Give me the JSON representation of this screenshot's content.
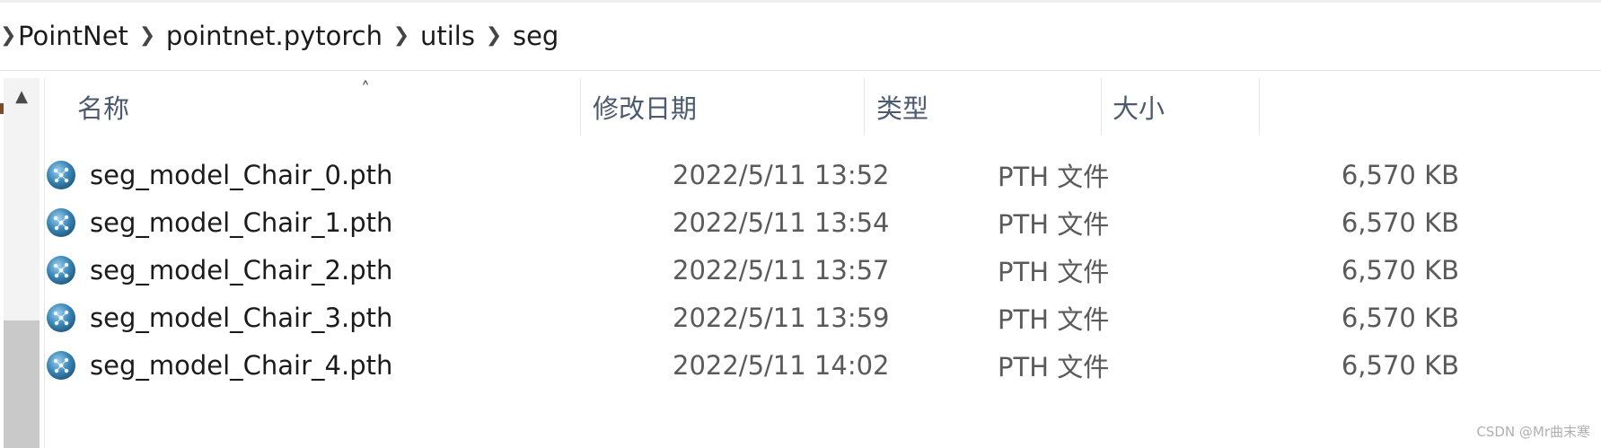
{
  "breadcrumb": {
    "items": [
      "PointNet",
      "pointnet.pytorch",
      "utils",
      "seg"
    ]
  },
  "columns": {
    "name": "名称",
    "date": "修改日期",
    "type": "类型",
    "size": "大小"
  },
  "files": [
    {
      "name": "seg_model_Chair_0.pth",
      "date": "2022/5/11 13:52",
      "type": "PTH 文件",
      "size": "6,570 KB",
      "icon": "pth-file-icon"
    },
    {
      "name": "seg_model_Chair_1.pth",
      "date": "2022/5/11 13:54",
      "type": "PTH 文件",
      "size": "6,570 KB",
      "icon": "pth-file-icon"
    },
    {
      "name": "seg_model_Chair_2.pth",
      "date": "2022/5/11 13:57",
      "type": "PTH 文件",
      "size": "6,570 KB",
      "icon": "pth-file-icon"
    },
    {
      "name": "seg_model_Chair_3.pth",
      "date": "2022/5/11 13:59",
      "type": "PTH 文件",
      "size": "6,570 KB",
      "icon": "pth-file-icon"
    },
    {
      "name": "seg_model_Chair_4.pth",
      "date": "2022/5/11 14:02",
      "type": "PTH 文件",
      "size": "6,570 KB",
      "icon": "pth-file-icon"
    }
  ],
  "sort": {
    "column": "name",
    "direction": "ascending"
  },
  "watermark": "CSDN @Mr曲末寒",
  "colors": {
    "header_text": "#4b5a6f",
    "icon_blue": "#3a87b8"
  }
}
